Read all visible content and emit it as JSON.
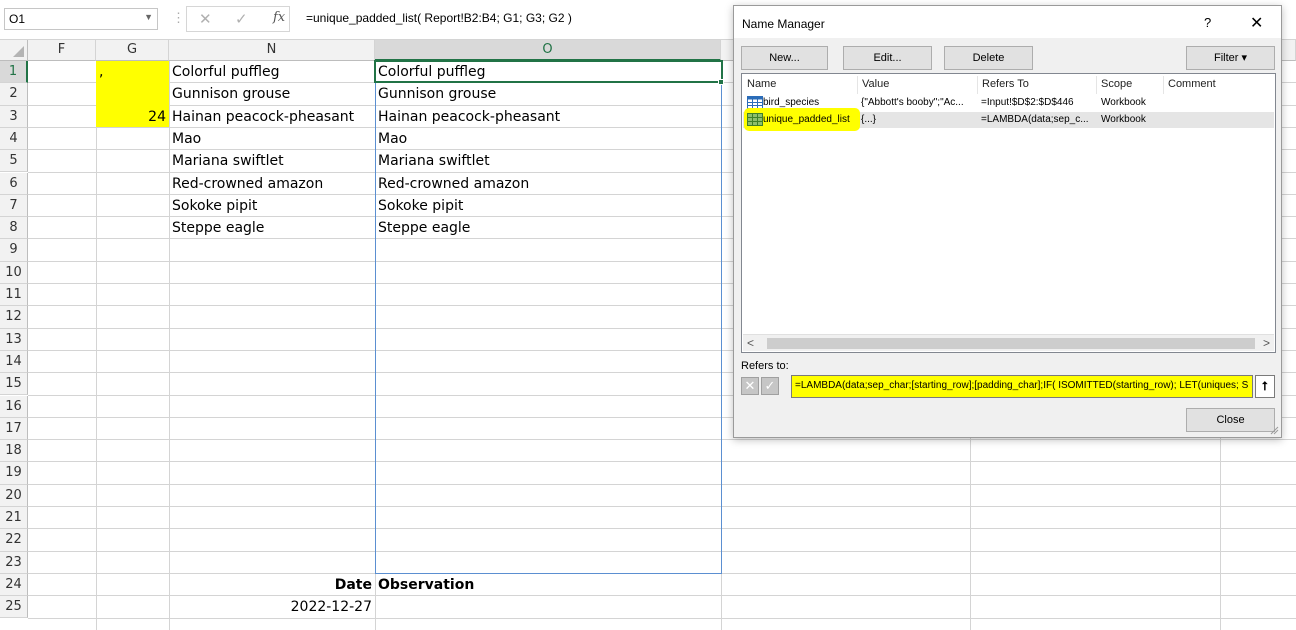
{
  "formula_bar": {
    "name_box": "O1",
    "formula": "=unique_padded_list( Report!B2:B4; G1; G3; G2 )",
    "cancel_glyph": "✕",
    "enter_glyph": "✓",
    "fx_label": "fx"
  },
  "grid": {
    "columns": [
      "F",
      "G",
      "N",
      "O"
    ],
    "selected_column": "O",
    "rows": [
      "1",
      "2",
      "3",
      "4",
      "5",
      "6",
      "7",
      "8",
      "9",
      "10",
      "11",
      "12",
      "13",
      "14",
      "15",
      "16",
      "17",
      "18",
      "19",
      "20",
      "21",
      "22",
      "23",
      "24",
      "25"
    ],
    "selected_row": "1",
    "cells": {
      "G1": ",",
      "G3": "24",
      "N1": "Colorful puffleg",
      "N2": "Gunnison grouse",
      "N3": "Hainan peacock-pheasant",
      "N4": "Mao",
      "N5": "Mariana swiftlet",
      "N6": "Red-crowned amazon",
      "N7": "Sokoke pipit",
      "N8": "Steppe eagle",
      "O1": "Colorful puffleg",
      "O2": "Gunnison grouse",
      "O3": "Hainan peacock-pheasant",
      "O4": "Mao",
      "O5": "Mariana swiftlet",
      "O6": "Red-crowned amazon",
      "O7": "Sokoke pipit",
      "O8": "Steppe eagle",
      "N24": "Date",
      "O24": "Observation",
      "N25": "2022-12-27"
    },
    "highlight_color": "#ffff00",
    "accent_color": "#217346"
  },
  "name_manager": {
    "title": "Name Manager",
    "help": "?",
    "close_x": "✕",
    "buttons": {
      "new": "New...",
      "edit": "Edit...",
      "delete": "Delete",
      "filter": "Filter ▾",
      "close": "Close"
    },
    "columns": [
      "Name",
      "Value",
      "Refers To",
      "Scope",
      "Comment"
    ],
    "rows": [
      {
        "name": "bird_species",
        "value": "{\"Abbott's booby\";\"Ac...",
        "refers_to": "=Input!$D$2:$D$446",
        "scope": "Workbook",
        "comment": "",
        "icon": "table-icon"
      },
      {
        "name": "unique_padded_list",
        "value": "{...}",
        "refers_to": "=LAMBDA(data;sep_c...",
        "scope": "Workbook",
        "comment": "",
        "icon": "lambda-name-icon"
      }
    ],
    "refers_to_label": "Refers to:",
    "refers_to_value": "=LAMBDA(data;sep_char;[starting_row];[padding_char];IF( ISOMITTED(starting_row); LET(uniques; S",
    "scroll_left": "<",
    "scroll_right": ">"
  }
}
